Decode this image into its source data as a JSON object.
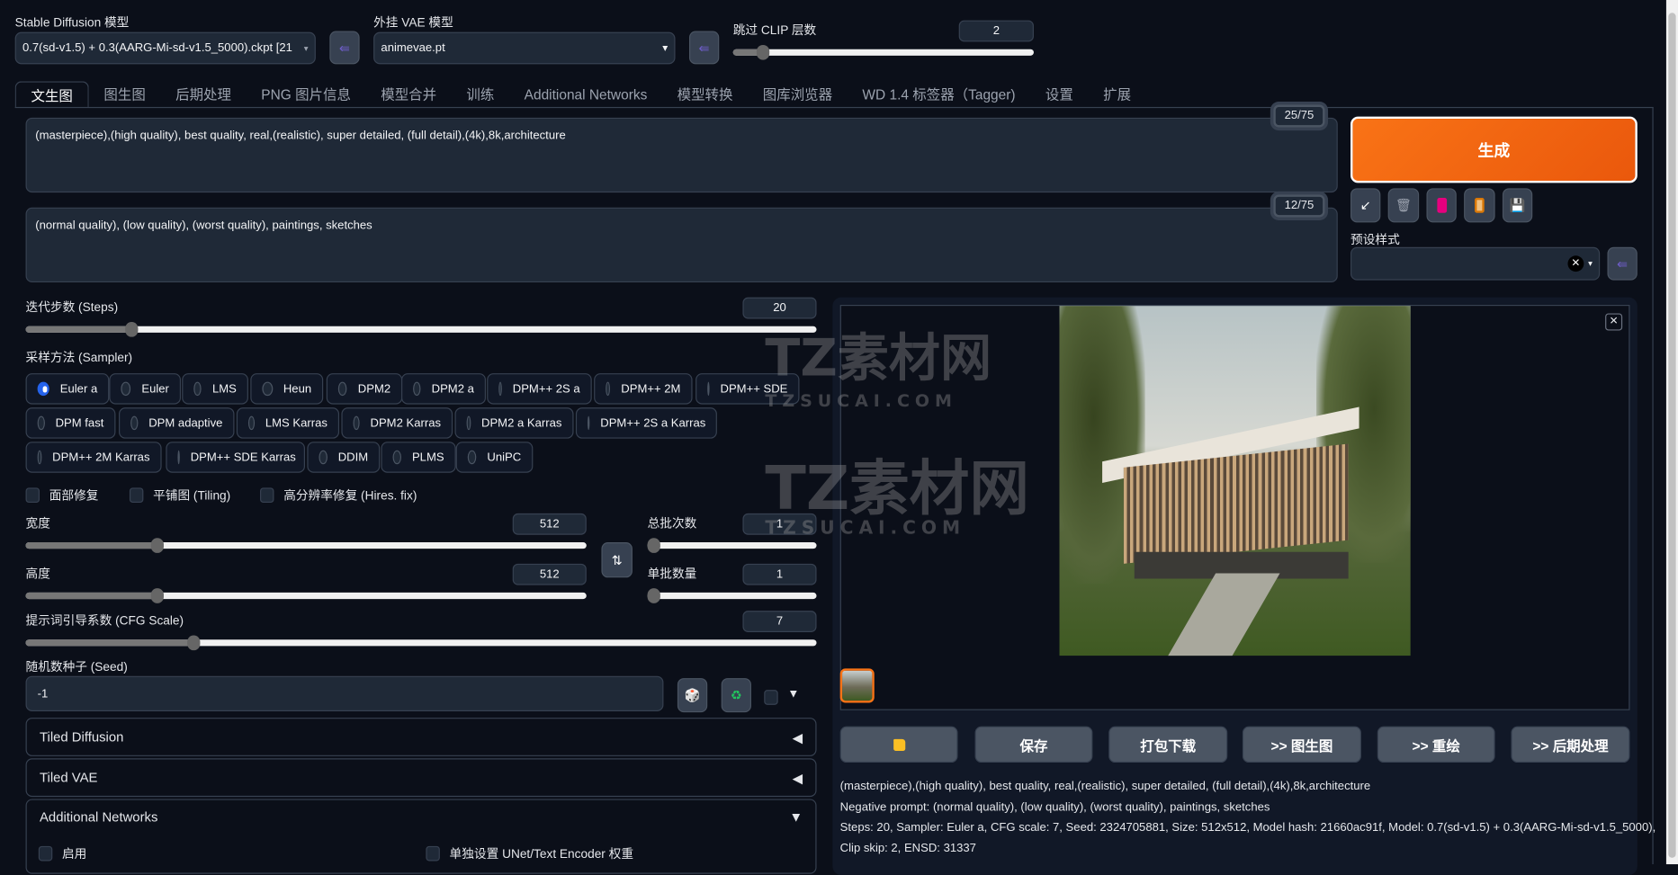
{
  "top": {
    "sd_model_label": "Stable Diffusion 模型",
    "sd_model_value": "0.7(sd-v1.5) + 0.3(AARG-Mi-sd-v1.5_5000).ckpt [21",
    "vae_label": "外挂 VAE 模型",
    "vae_value": "animevae.pt",
    "clip_label": "跳过 CLIP 层数",
    "clip_value": "2",
    "clip_fraction": 0.1
  },
  "tabs": [
    "文生图",
    "图生图",
    "后期处理",
    "PNG 图片信息",
    "模型合并",
    "训练",
    "Additional Networks",
    "模型转换",
    "图库浏览器",
    "WD 1.4 标签器（Tagger)",
    "设置",
    "扩展"
  ],
  "prompt": {
    "text": "(masterpiece),(high quality), best quality, real,(realistic), super detailed, (full detail),(4k),8k,architecture",
    "tokens": "25/75"
  },
  "negative": {
    "text": "(normal quality), (low quality), (worst quality), paintings, sketches",
    "tokens": "12/75"
  },
  "generate_label": "生成",
  "styles_label": "预设样式",
  "steps": {
    "label": "迭代步数 (Steps)",
    "value": "20",
    "fraction": 0.134
  },
  "sampler": {
    "label": "采样方法 (Sampler)",
    "selected": "Euler a",
    "options": [
      "Euler a",
      "Euler",
      "LMS",
      "Heun",
      "DPM2",
      "DPM2 a",
      "DPM++ 2S a",
      "DPM++ 2M",
      "DPM++ SDE",
      "DPM fast",
      "DPM adaptive",
      "LMS Karras",
      "DPM2 Karras",
      "DPM2 a Karras",
      "DPM++ 2S a Karras",
      "DPM++ 2M Karras",
      "DPM++ SDE Karras",
      "DDIM",
      "PLMS",
      "UniPC"
    ]
  },
  "checks": {
    "face": "面部修复",
    "tiling": "平铺图 (Tiling)",
    "hires": "高分辨率修复 (Hires. fix)"
  },
  "width": {
    "label": "宽度",
    "value": "512",
    "fraction": 0.235
  },
  "height": {
    "label": "高度",
    "value": "512",
    "fraction": 0.235
  },
  "batch_count": {
    "label": "总批次数",
    "value": "1",
    "fraction": 0
  },
  "batch_size": {
    "label": "单批数量",
    "value": "1",
    "fraction": 0
  },
  "cfg": {
    "label": "提示词引导系数 (CFG Scale)",
    "value": "7",
    "fraction": 0.212
  },
  "seed": {
    "label": "随机数种子 (Seed)",
    "value": "-1"
  },
  "accordions": {
    "tiled_diffusion": "Tiled Diffusion",
    "tiled_vae": "Tiled VAE",
    "additional_networks": "Additional Networks",
    "enable": "启用",
    "separate": "单独设置 UNet/Text Encoder 权重"
  },
  "gallery_buttons": {
    "save": "保存",
    "zip": "打包下载",
    "img2img": ">> 图生图",
    "inpaint": ">> 重绘",
    "extras": ">> 后期处理"
  },
  "info": [
    "(masterpiece),(high quality), best quality, real,(realistic), super detailed, (full detail),(4k),8k,architecture",
    "Negative prompt: (normal quality), (low quality), (worst quality), paintings, sketches",
    "Steps: 20, Sampler: Euler a, CFG scale: 7, Seed: 2324705881, Size: 512x512, Model hash: 21660ac91f, Model: 0.7(sd-v1.5) + 0.3(AARG-Mi-sd-v1.5_5000),",
    "Clip skip: 2, ENSD: 31337"
  ],
  "watermark": {
    "cn": "TZ素材网",
    "en": "TZSUCAI.COM"
  },
  "colors": {
    "accent": "#f97316",
    "background": "#0b0f19",
    "input": "#1f2937",
    "radio_selected": "#2563eb"
  }
}
